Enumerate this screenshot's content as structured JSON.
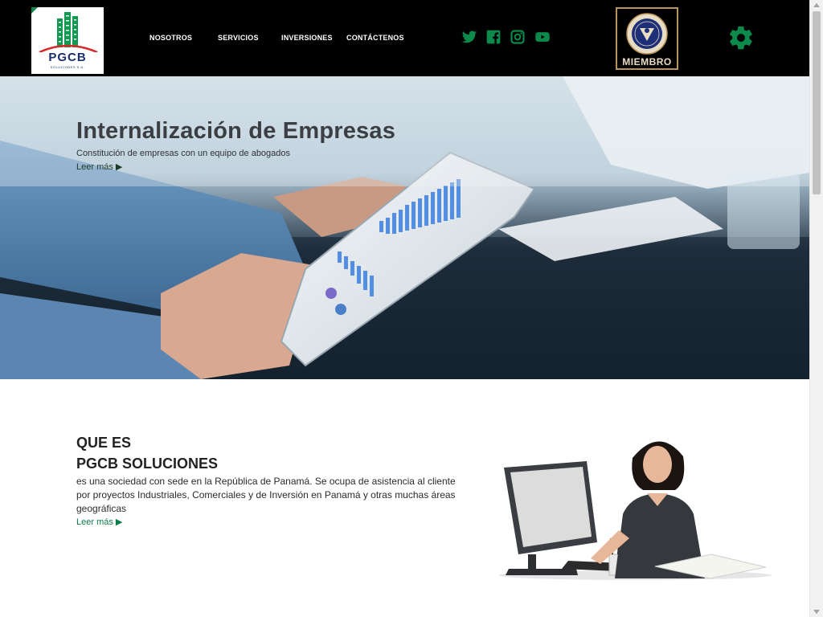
{
  "header": {
    "logo": {
      "name": "PGCB",
      "sub": "SOLUCIONES S.A."
    },
    "nav": [
      "NOSOTROS",
      "SERVICIOS",
      "INVERSIONES",
      "CONTÁCTENOS"
    ],
    "social_icons": [
      "twitter-icon",
      "facebook-icon",
      "instagram-icon",
      "youtube-icon"
    ],
    "member_label": "MIEMBRO",
    "settings_icon": "gear-icon"
  },
  "hero": {
    "title": "Internalización de Empresas",
    "subtitle": "Constitución de empresas con un equipo de abogados",
    "link": "Leer más ▶"
  },
  "about": {
    "heading_line1": "QUE ES",
    "heading_line2": "PGCB SOLUCIONES",
    "body": "es una sociedad con sede en la República de Panamá. Se ocupa de asistencia al cliente por proyectos Industriales, Comerciales y de Inversión en Panamá y otras muchas áreas geográficas",
    "link": "Leer más ▶"
  },
  "colors": {
    "accent": "#0d8a4b",
    "header_bg": "#000000",
    "member_border": "#b9945a"
  }
}
